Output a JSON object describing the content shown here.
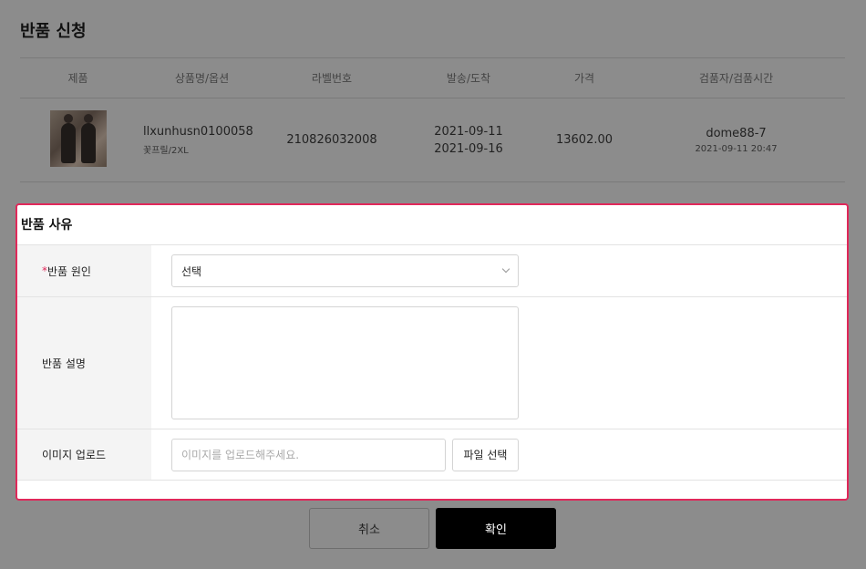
{
  "page": {
    "title": "반품 신청"
  },
  "table": {
    "headers": [
      "제품",
      "상품명/옵션",
      "라벨번호",
      "발송/도착",
      "가격",
      "검품자/검품시간"
    ],
    "row": {
      "product_name": "llxunhusn0100058",
      "option": "꽃프릴/2XL",
      "label_no": "210826032008",
      "ship_date": "2021-09-11",
      "arrive_date": "2021-09-16",
      "price": "13602.00",
      "inspector": "dome88-7",
      "inspect_time": "2021-09-11 20:47"
    }
  },
  "reason": {
    "title": "반품 사유",
    "cause_required_mark": "*",
    "cause_label": "반품 원인",
    "cause_value": "선택",
    "desc_label": "반품 설명",
    "image_label": "이미지 업로드",
    "image_placeholder": "이미지를 업로드해주세요.",
    "file_button": "파일 선택"
  },
  "footer": {
    "cancel": "취소",
    "confirm": "확인"
  },
  "colors": {
    "accent_border": "#e0285a",
    "confirm_bg": "#000000",
    "overlay": "#8c8c8c"
  }
}
